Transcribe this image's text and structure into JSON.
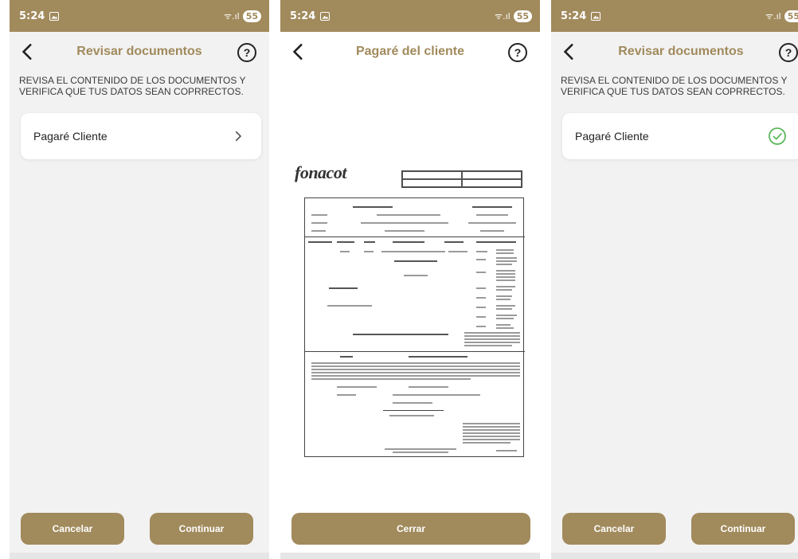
{
  "status_bar": {
    "time": "5:24",
    "battery": "55",
    "signal": "ᯤ.ıl"
  },
  "screen1": {
    "title": "Revisar documentos",
    "instructions": "REVISA EL CONTENIDO DE LOS DOCUMENTOS Y VERIFICA QUE TUS DATOS SEAN COPRRECTOS.",
    "document_label": "Pagaré Cliente",
    "cancel_label": "Cancelar",
    "continue_label": "Continuar"
  },
  "screen2": {
    "title": "Pagaré del cliente",
    "close_label": "Cerrar",
    "document_logo": "fonacot"
  },
  "screen3": {
    "title": "Revisar documentos",
    "instructions": "REVISA EL CONTENIDO DE LOS DOCUMENTOS Y VERIFICA QUE TUS DATOS SEAN COPRRECTOS.",
    "document_label": "Pagaré Cliente",
    "cancel_label": "Cancelar",
    "continue_label": "Continuar"
  },
  "colors": {
    "accent": "#a18a5c",
    "check": "#5cb85c"
  },
  "icons": {
    "back": "chevron-left-icon",
    "help": "question-circle-icon",
    "open": "chevron-right-icon",
    "verified": "check-circle-icon",
    "gallery": "image-icon"
  }
}
